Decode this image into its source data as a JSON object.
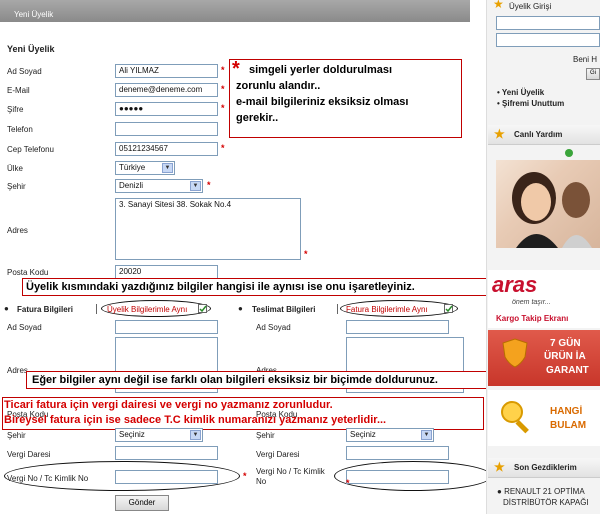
{
  "header": {
    "title": "Yeni Üyelik"
  },
  "form": {
    "title": "Yeni Üyelik",
    "fields": {
      "ad_soyad": {
        "label": "Ad Soyad",
        "value": "Ali YILMAZ"
      },
      "email": {
        "label": "E-Mail",
        "value": "deneme@deneme.com"
      },
      "sifre": {
        "label": "Şifre",
        "value": "●●●●●"
      },
      "telefon": {
        "label": "Telefon",
        "value": ""
      },
      "cep": {
        "label": "Cep Telefonu",
        "value": "05121234567"
      },
      "ulke": {
        "label": "Ülke",
        "value": "Türkiye"
      },
      "sehir": {
        "label": "Şehir",
        "value": "Denizli"
      },
      "adres": {
        "label": "Adres",
        "value": "3. Sanayi Sitesi 38. Sokak No.4"
      },
      "posta": {
        "label": "Posta Kodu",
        "value": "20020"
      }
    },
    "required_mark": "*"
  },
  "annotations": {
    "box1_star": "*",
    "box1_line1": "simgeli yerler doldurulması",
    "box1_line2": "zorunlu alandır..",
    "box1_line3": "e-mail bilgileriniz eksiksiz olması",
    "box1_line4": "gerekir..",
    "box2": "Üyelik kısmındaki yazdığınız bilgiler hangisi ile aynısı ise onu işaretleyiniz.",
    "box3": "Eğer bilgiler aynı değil ise farklı olan bilgileri eksiksiz bir biçimde doldurunuz.",
    "box4_line1": "Ticari fatura için vergi dairesi ve vergi no yazmanız zorunludur.",
    "box4_line2": "Bireysel fatura için ise sadece T.C kimlik numaranızı yazmanız yeterlidir..."
  },
  "fatura": {
    "title": "Fatura Bilgileri",
    "same_label": "Üyelik Bilgilerimle Aynı",
    "ad_soyad": "Ad Soyad",
    "adres": "Adres",
    "posta": "Posta Kodu",
    "sehir": "Şehir",
    "sehir_value": "Seçiniz",
    "vergi_dairesi": "Vergi Daresi",
    "vergi_no": "Vergi No / Tc Kimlik No",
    "required_mark": "*"
  },
  "teslimat": {
    "title": "Teslimat Bilgileri",
    "same_label": "Fatura Bilgilerimle Aynı",
    "ad_soyad": "Ad Soyad",
    "adres": "Adres",
    "posta": "Posta Kodu",
    "sehir": "Şehir",
    "sehir_value": "Seçiniz",
    "vergi_dairesi": "Vergi Daresi",
    "vergi_no_line1": "Vergi No / Tc Kimlik",
    "vergi_no_line2": "No",
    "required_mark": "*"
  },
  "submit_label": "Gönder",
  "sidebar": {
    "login": {
      "title": "Üyelik Girişi",
      "remember": "Beni H",
      "go": "Gi",
      "links": [
        "Yeni Üyelik",
        "Şifremi Unuttum"
      ]
    },
    "live_help": {
      "title": "Canlı Yardım"
    },
    "aras": {
      "brand": "aras",
      "slogan": "önem taşır...",
      "tracking": "Kargo Takip Ekranı"
    },
    "guarantee": {
      "line1": "7 GÜN",
      "line2": "ÜRÜN İA",
      "line3": "GARANT"
    },
    "find": {
      "line1": "HANGİ",
      "line2": "BULAM"
    },
    "recent": {
      "title": "Son Gezdiklerim",
      "item_line1": "RENAULT 21 OPTİMA",
      "item_line2": "DİSTRİBÜTÖR KAPAĞI"
    }
  },
  "colors": {
    "accent_red": "#d40000",
    "aras_red": "#c8102e"
  }
}
